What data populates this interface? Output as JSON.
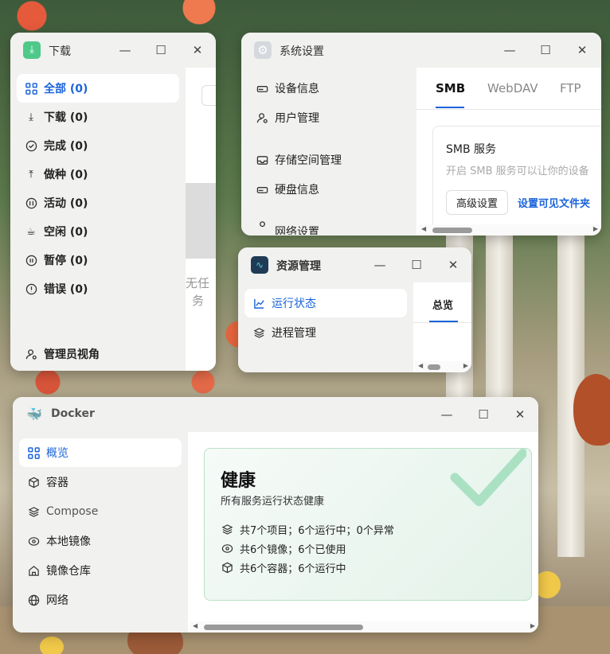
{
  "download_window": {
    "title": "下载",
    "nav": [
      {
        "label": "全部 (0)",
        "active": true
      },
      {
        "label": "下载 (0)"
      },
      {
        "label": "完成 (0)"
      },
      {
        "label": "做种 (0)"
      },
      {
        "label": "活动 (0)"
      },
      {
        "label": "空闲 (0)"
      },
      {
        "label": "暂停 (0)"
      },
      {
        "label": "错误 (0)"
      }
    ],
    "admin_view_label": "管理员视角",
    "empty_text_line1": "无任",
    "empty_text_line2": "务"
  },
  "settings_window": {
    "title": "系统设置",
    "nav": [
      {
        "label": "设备信息"
      },
      {
        "label": "用户管理"
      },
      {
        "label": "存储空间管理"
      },
      {
        "label": "硬盘信息"
      },
      {
        "label": "网络设置"
      }
    ],
    "tabs": [
      {
        "label": "SMB",
        "active": true
      },
      {
        "label": "WebDAV"
      },
      {
        "label": "FTP"
      }
    ],
    "smb_card": {
      "title": "SMB 服务",
      "description": "开启 SMB 服务可以让你的设备",
      "advanced_button": "高级设置",
      "visible_folders_link": "设置可见文件夹"
    }
  },
  "resource_window": {
    "title": "资源管理",
    "nav": [
      {
        "label": "运行状态",
        "active": true
      },
      {
        "label": "进程管理"
      }
    ],
    "tab_overview": "总览"
  },
  "docker_window": {
    "title": "Docker",
    "nav": [
      {
        "label": "概览",
        "active": true
      },
      {
        "label": "容器"
      },
      {
        "label": "Compose"
      },
      {
        "label": "本地镜像"
      },
      {
        "label": "镜像仓库"
      },
      {
        "label": "网络"
      }
    ],
    "health": {
      "title": "健康",
      "subtitle": "所有服务运行状态健康",
      "stats": [
        "共7个项目；6个运行中；0个异常",
        "共6个镜像；6个已使用",
        "共6个容器；6个运行中"
      ]
    },
    "colors": {
      "accent": "#1b64da",
      "health_bg": "#eef7f1",
      "health_border": "#b9e0c8",
      "check": "#8fd8b0"
    }
  }
}
